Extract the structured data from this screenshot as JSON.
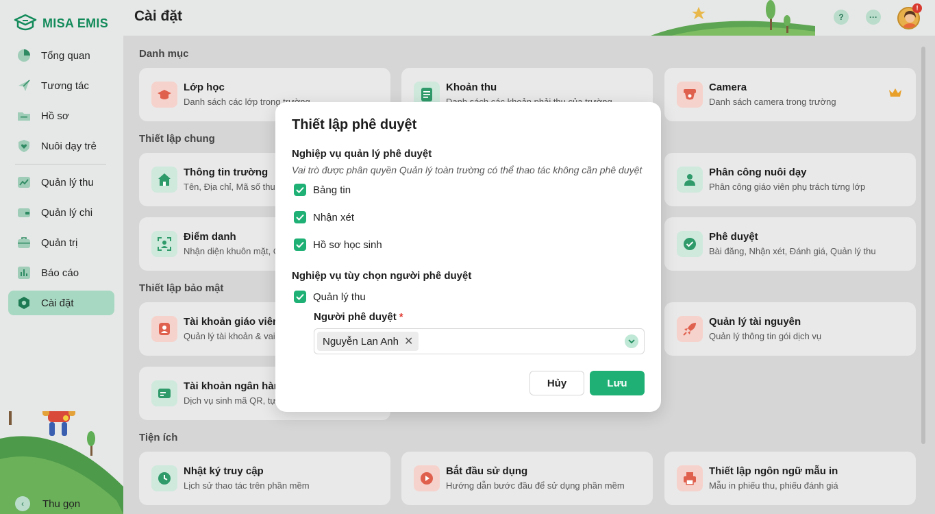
{
  "app": {
    "logo_text": "MISA EMIS"
  },
  "sidebar": {
    "items": [
      {
        "label": "Tổng quan",
        "icon": "pie-chart-icon"
      },
      {
        "label": "Tương tác",
        "icon": "paper-plane-icon"
      },
      {
        "label": "Hồ sơ",
        "icon": "folder-icon"
      },
      {
        "label": "Nuôi dạy trẻ",
        "icon": "heart-shield-icon"
      },
      {
        "label": "Quản lý thu",
        "icon": "income-chart-icon"
      },
      {
        "label": "Quản lý chi",
        "icon": "wallet-icon"
      },
      {
        "label": "Quản trị",
        "icon": "briefcase-icon"
      },
      {
        "label": "Báo cáo",
        "icon": "bar-chart-icon"
      },
      {
        "label": "Cài đặt",
        "icon": "settings-icon"
      }
    ],
    "active": "Cài đặt",
    "collapse_label": "Thu gọn"
  },
  "header": {
    "title": "Cài đặt",
    "help_icon": "help-icon",
    "more_icon": "more-icon",
    "notification_badge": "!"
  },
  "sections": [
    {
      "title": "Danh mục"
    },
    {
      "title": "Thiết lập chung"
    },
    {
      "title": "Thiết lập bảo mật"
    },
    {
      "title": "Tiện ích"
    }
  ],
  "cards": [
    {
      "title": "Lớp học",
      "desc": "Danh sách các lớp trong trường"
    },
    {
      "title": "Khoản thu",
      "desc": "Danh sách các khoản phải thu của trường"
    },
    {
      "title": "Camera",
      "desc": "Danh sách camera trong trường"
    },
    {
      "title": "Thông tin trường",
      "desc": "Tên, Địa chỉ, Mã số thuế"
    },
    {
      "title": "Phân công nuôi dạy",
      "desc": "Phân công giáo viên phụ trách từng lớp"
    },
    {
      "title": "Điểm danh",
      "desc": "Nhận diện khuôn mặt, C"
    },
    {
      "title": "Phê duyệt",
      "desc": "Bài đăng, Nhận xét, Đánh giá, Quản lý thu"
    },
    {
      "title": "Tài khoản giáo viên",
      "desc": "Quản lý tài khoản & vai t"
    },
    {
      "title": "Quản lý tài nguyên",
      "desc": "Quản lý thông tin gói dịch vụ"
    },
    {
      "title": "Tài khoản ngân hàng",
      "desc": "Dịch vụ sinh mã QR, tự đ"
    },
    {
      "title": "Nhật ký truy cập",
      "desc": "Lịch sử thao tác trên phần mềm"
    },
    {
      "title": "Bắt đầu sử dụng",
      "desc": "Hướng dẫn bước đầu để sử dụng phần mềm"
    },
    {
      "title": "Thiết lập ngôn ngữ mẫu in",
      "desc": "Mẫu in phiếu thu, phiếu đánh giá"
    }
  ],
  "modal": {
    "title": "Thiết lập phê duyệt",
    "section1_title": "Nghiệp vụ quản lý phê duyệt",
    "section1_note": "Vai trò được phân quyền Quản lý toàn trường có thể thao tác không cần phê duyệt",
    "section1_items": [
      {
        "label": "Bảng tin",
        "checked": true
      },
      {
        "label": "Nhận xét",
        "checked": true
      },
      {
        "label": "Hồ sơ học sinh",
        "checked": true
      }
    ],
    "section2_title": "Nghiệp vụ tùy chọn người phê duyệt",
    "section2_item": {
      "label": "Quản lý thu",
      "checked": true
    },
    "approver_label": "Người phê duyệt",
    "required_mark": "*",
    "approver_selected": "Nguyễn Lan Anh",
    "cancel_label": "Hủy",
    "save_label": "Lưu"
  },
  "colors": {
    "brand": "#1eb075",
    "brand_dark": "#128a5a",
    "active_nav": "#a7d8c2",
    "required": "#e03a2f"
  }
}
